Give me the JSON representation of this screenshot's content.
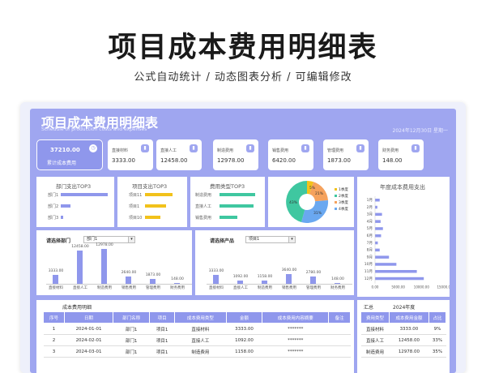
{
  "hero": {
    "title": "项目成本费用明细表",
    "subtitle": "公式自动统计 / 动态图表分析 / 可编辑修改"
  },
  "sheet": {
    "title": "项目成本费用明细表",
    "subtitle_en": "Schedule of production costs and expenses",
    "date": "2024年12月30日  星期一"
  },
  "kpis": {
    "total": {
      "value": "37210.00",
      "label": "累计成本费用"
    },
    "items": [
      {
        "label": "直接材料",
        "value": "3333.00"
      },
      {
        "label": "直接人工",
        "value": "12458.00"
      },
      {
        "label": "制造费用",
        "value": "12978.00"
      },
      {
        "label": "销售费用",
        "value": "6420.00"
      },
      {
        "label": "管理费用",
        "value": "1873.00"
      },
      {
        "label": "财务费用",
        "value": "148.00"
      }
    ]
  },
  "dept_top": {
    "title": "部门支出TOP3",
    "items": [
      "部门1",
      "部门2",
      "部门3"
    ],
    "values": [
      100,
      20,
      5
    ],
    "color": "#8f97ec"
  },
  "proj_top": {
    "title": "项目支出TOP3",
    "items": [
      "项目11",
      "项目1",
      "项目10"
    ],
    "values": [
      100,
      75,
      55
    ],
    "color": "#f2c21b"
  },
  "type_top": {
    "title": "费用类型TOP3",
    "items": [
      "制造费用",
      "直接人工",
      "销售费用"
    ],
    "values": [
      100,
      95,
      50
    ],
    "color": "#3fc7a0"
  },
  "pie": {
    "legend": [
      "1季度",
      "2季度",
      "3季度",
      "4季度"
    ],
    "labels": [
      "5%",
      "21%",
      "31%",
      "43%"
    ],
    "colors": [
      "#f2c21b",
      "#f5a25d",
      "#3fc7a0",
      "#6aa8f0"
    ]
  },
  "dept_chart": {
    "label": "请选择部门",
    "selected": "部门1",
    "categories": [
      "直接材料",
      "直接人工",
      "制造费用",
      "销售费用",
      "管理费用",
      "财务费用"
    ],
    "values": [
      3333,
      12458,
      12978,
      2640,
      1873,
      148
    ],
    "value_labels": [
      "3333.00",
      "12458.00",
      "12978.00",
      "2640.00",
      "1873.00",
      "148.00"
    ]
  },
  "proj_chart": {
    "label": "请选择产品",
    "selected": "项目1",
    "categories": [
      "直接材料",
      "直接人工",
      "制造费用",
      "销售费用",
      "管理费用",
      "财务费用"
    ],
    "values": [
      3333,
      1092,
      1158,
      3640,
      2780,
      148
    ],
    "value_labels": [
      "3333.00",
      "1092.00",
      "1158.00",
      "3640.00",
      "2780.00",
      "148.00"
    ]
  },
  "chart_data": {
    "type": "bar",
    "title": "年度成本费用支出",
    "categories": [
      "1月",
      "2月",
      "3月",
      "4月",
      "5月",
      "6月",
      "7月",
      "8月",
      "9月",
      "10月",
      "11月",
      "12月"
    ],
    "values": [
      1000,
      500,
      1500,
      1200,
      1700,
      1300,
      600,
      1000,
      3000,
      4600,
      9000,
      10500
    ],
    "xticks": [
      "0.00",
      "5000.00",
      "10000.00",
      "15000.00"
    ],
    "xlim": [
      0,
      15000
    ]
  },
  "table": {
    "title": "成本费用明细",
    "headers": [
      "序号",
      "日期",
      "部门名称",
      "项目",
      "成本费用类型",
      "金额",
      "成本费用内容摘要",
      "备注"
    ],
    "rows": [
      [
        "1",
        "2024-01-01",
        "部门1",
        "项目1",
        "直接材料",
        "3333.00",
        "*******",
        ""
      ],
      [
        "2",
        "2024-02-01",
        "部门1",
        "项目1",
        "直接人工",
        "1092.00",
        "*******",
        ""
      ],
      [
        "3",
        "2024-03-01",
        "部门1",
        "项目1",
        "制造费用",
        "1158.00",
        "*******",
        ""
      ]
    ]
  },
  "summary": {
    "title": "汇总",
    "year": "2024年度",
    "headers": [
      "费用类型",
      "成本费用金额",
      "占比"
    ],
    "rows": [
      [
        "直接材料",
        "3333.00",
        "9%"
      ],
      [
        "直接人工",
        "12458.00",
        "33%"
      ],
      [
        "制造费用",
        "12978.00",
        "35%"
      ]
    ]
  }
}
